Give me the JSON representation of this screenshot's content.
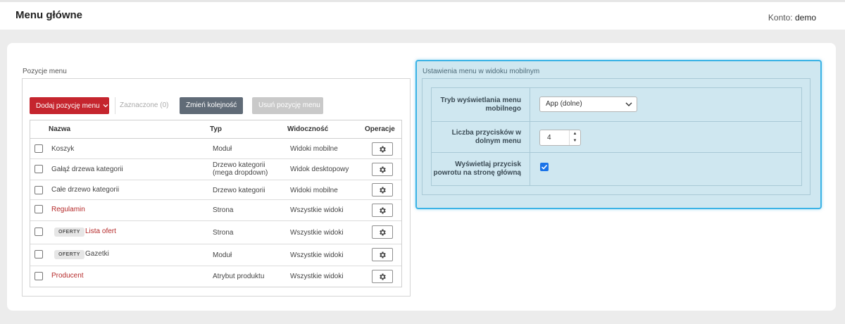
{
  "header": {
    "title": "Menu główne",
    "account_label": "Konto:",
    "account_user": "demo"
  },
  "menu_items": {
    "section_title": "Pozycje menu",
    "toolbar": {
      "add_label": "Dodaj pozycję menu",
      "selected_label": "Zaznaczone (0)",
      "reorder_label": "Zmień kolejność",
      "delete_label": "Usuń pozycję menu"
    },
    "columns": {
      "name": "Nazwa",
      "type": "Typ",
      "visibility": "Widoczność",
      "operations": "Operacje"
    },
    "rows": [
      {
        "name": "Koszyk",
        "type": "Moduł",
        "visibility": "Widoki mobilne",
        "tag": "",
        "highlighted": false
      },
      {
        "name": "Gałąź drzewa kategorii",
        "type": "Drzewo kategorii",
        "type_line2": "(mega dropdown)",
        "visibility": "Widok desktopowy",
        "tag": "",
        "highlighted": false
      },
      {
        "name": "Całe drzewo kategorii",
        "type": "Drzewo kategorii",
        "visibility": "Widoki mobilne",
        "tag": "",
        "highlighted": false
      },
      {
        "name": "Regulamin",
        "type": "Strona",
        "visibility": "Wszystkie widoki",
        "tag": "",
        "highlighted": true
      },
      {
        "name": "Lista ofert",
        "type": "Strona",
        "visibility": "Wszystkie widoki",
        "tag": "OFERTY",
        "highlighted": true
      },
      {
        "name": "Gazetki",
        "type": "Moduł",
        "visibility": "Wszystkie widoki",
        "tag": "OFERTY",
        "highlighted": false
      },
      {
        "name": "Producent",
        "type": "Atrybut produktu",
        "visibility": "Wszystkie widoki",
        "tag": "",
        "highlighted": true
      }
    ]
  },
  "mobile_settings": {
    "section_title": "Ustawienia menu w widoku mobilnym",
    "display_mode_label": "Tryb wyświetlania menu mobilnego",
    "display_mode_value": "App (dolne)",
    "button_count_label": "Liczba przycisków w dolnym menu",
    "button_count_value": "4",
    "show_home_label": "Wyświetlaj przycisk powrotu na stronę główną",
    "show_home_checked": true
  },
  "colors": {
    "accent_red": "#c5252e",
    "panel_highlight": "#3bb3e6",
    "checkbox_blue": "#1a73e8"
  },
  "icons": {
    "operations": "gear-icon",
    "dropdown": "chevron-down-icon"
  }
}
